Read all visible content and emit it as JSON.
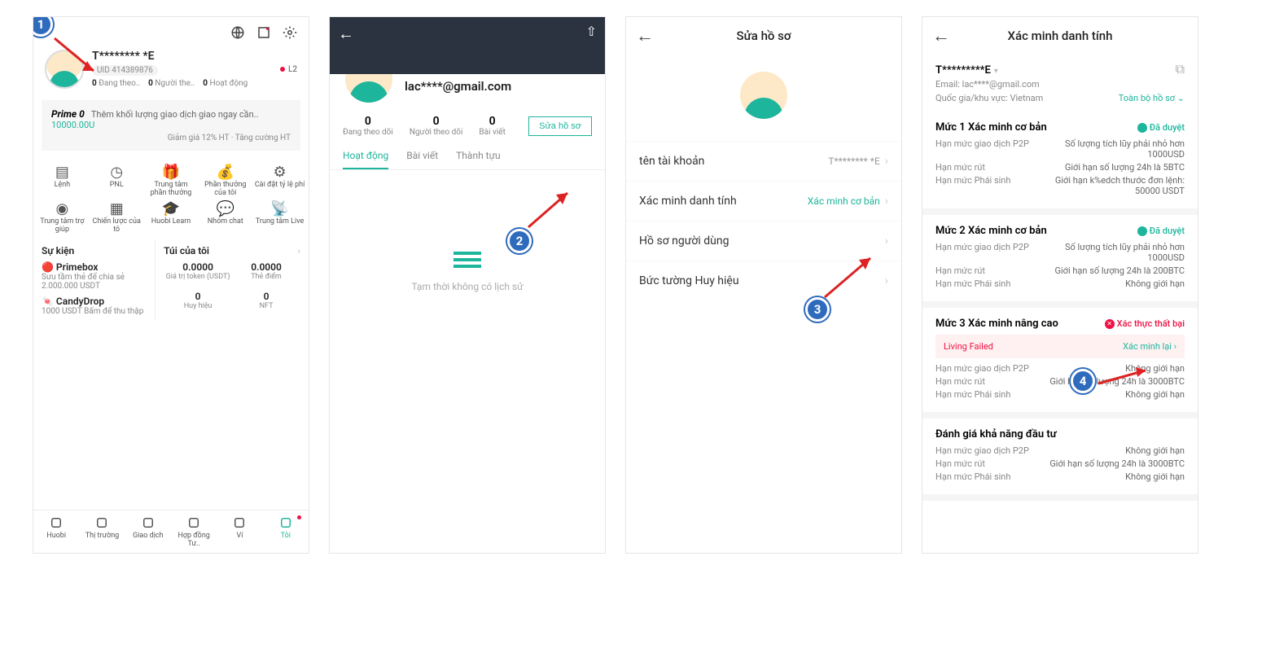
{
  "s1": {
    "username": "T******** *E",
    "uid": "UID 414389876",
    "l2": "L2",
    "follow": {
      "following_n": "0",
      "following_l": "Đang theo..",
      "followers_n": "0",
      "followers_l": "Người the..",
      "act_n": "0",
      "act_l": "Hoạt động"
    },
    "prime": {
      "title": "Prime 0",
      "text": "Thêm khối lượng giao dịch giao ngay cần..",
      "amount": "10000.00U",
      "sub": "Giảm giá 12% HT · Tăng cường HT"
    },
    "grid": [
      {
        "l": "Lệnh"
      },
      {
        "l": "PNL"
      },
      {
        "l": "Trung tâm phần thưởng"
      },
      {
        "l": "Phần thưởng của tôi"
      },
      {
        "l": "Cài đặt tỷ lệ phí"
      },
      {
        "l": "Trung tâm trợ giúp"
      },
      {
        "l": "Chiến lược của tô"
      },
      {
        "l": "Huobi Learn"
      },
      {
        "l": "Nhóm chat"
      },
      {
        "l": "Trung tâm Live"
      }
    ],
    "events_title": "Sự kiện",
    "events": [
      {
        "t": "Primebox",
        "s": "Sưu tầm thẻ để chia sẻ 2.000.000 USDT"
      },
      {
        "t": "CandyDrop",
        "s": "1000 USDT  Bấm để thu thập"
      }
    ],
    "bag_title": "Túi của tôi",
    "bag": [
      {
        "v": "0.0000",
        "l": "Giá trị token (USDT)"
      },
      {
        "v": "0.0000",
        "l": "Thẻ điểm"
      },
      {
        "v": "0",
        "l": "Huy hiệu"
      },
      {
        "v": "0",
        "l": "NFT"
      }
    ],
    "nav": [
      {
        "l": "Huobi"
      },
      {
        "l": "Thị trường"
      },
      {
        "l": "Giao dịch"
      },
      {
        "l": "Hợp đồng Tư.."
      },
      {
        "l": "Ví"
      },
      {
        "l": "Tôi"
      }
    ]
  },
  "s2": {
    "email": "lac****@gmail.com",
    "stats": [
      {
        "n": "0",
        "c": "Đang theo dõi"
      },
      {
        "n": "0",
        "c": "Người theo dõi"
      },
      {
        "n": "0",
        "c": "Bài viết"
      }
    ],
    "edit": "Sửa hồ sơ",
    "tabs": [
      "Hoạt động",
      "Bài viết",
      "Thành tựu"
    ],
    "empty": "Tạm thời không có lịch sử"
  },
  "s3": {
    "title": "Sửa hồ sơ",
    "rows": [
      {
        "lab": "tên tài khoản",
        "val": "T******** *E",
        "link": false
      },
      {
        "lab": "Xác minh danh tính",
        "val": "Xác minh cơ bản",
        "link": true
      },
      {
        "lab": "Hồ sơ người dùng",
        "val": "",
        "link": false
      },
      {
        "lab": "Bức tường Huy hiệu",
        "val": "",
        "link": false
      }
    ]
  },
  "s4": {
    "title": "Xác minh danh tính",
    "uname": "T*********E",
    "email_l": "Email:",
    "email_v": "lac****@gmail.com",
    "country_l": "Quốc gia/khu vực:",
    "country_v": "Vietnam",
    "full": "Toàn bộ hồ sơ",
    "levels": [
      {
        "h": "Mức 1 Xác minh cơ bản",
        "status": "Đã duyệt",
        "ok": true,
        "kv": [
          {
            "k": "Hạn mức giao dịch P2P",
            "v": "Số lượng tích lũy phải nhỏ hơn 1000USD"
          },
          {
            "k": "Hạn mức rút",
            "v": "Giới hạn số lượng 24h là 5BTC"
          },
          {
            "k": "Hạn mức Phái sinh",
            "v": "Giới hạn k%edch thước đơn lệnh: 50000 USDT"
          }
        ]
      },
      {
        "h": "Mức 2 Xác minh cơ bản",
        "status": "Đã duyệt",
        "ok": true,
        "kv": [
          {
            "k": "Hạn mức giao dịch P2P",
            "v": "Số lượng tích lũy phải nhỏ hơn 1000USD"
          },
          {
            "k": "Hạn mức rút",
            "v": "Giới hạn số lượng 24h là 200BTC"
          },
          {
            "k": "Hạn mức Phái sinh",
            "v": "Không giới hạn"
          }
        ]
      },
      {
        "h": "Mức 3 Xác minh nâng cao",
        "status": "Xác thực thất bại",
        "ok": false,
        "alert": "Living Failed",
        "retry": "Xác minh lại",
        "kv": [
          {
            "k": "Hạn mức giao dịch P2P",
            "v": "Không giới hạn"
          },
          {
            "k": "Hạn mức rút",
            "v": "Giới hạn số lượng 24h là 3000BTC"
          },
          {
            "k": "Hạn mức Phái sinh",
            "v": "Không giới hạn"
          }
        ]
      },
      {
        "h": "Đánh giá khả năng đầu tư",
        "status": "",
        "ok": null,
        "kv": [
          {
            "k": "Hạn mức giao dịch P2P",
            "v": "Không giới hạn"
          },
          {
            "k": "Hạn mức rút",
            "v": "Giới hạn số lượng 24h là 3000BTC"
          },
          {
            "k": "Hạn mức Phái sinh",
            "v": "Không giới hạn"
          }
        ]
      }
    ]
  },
  "steps": [
    "1",
    "2",
    "3",
    "4"
  ]
}
